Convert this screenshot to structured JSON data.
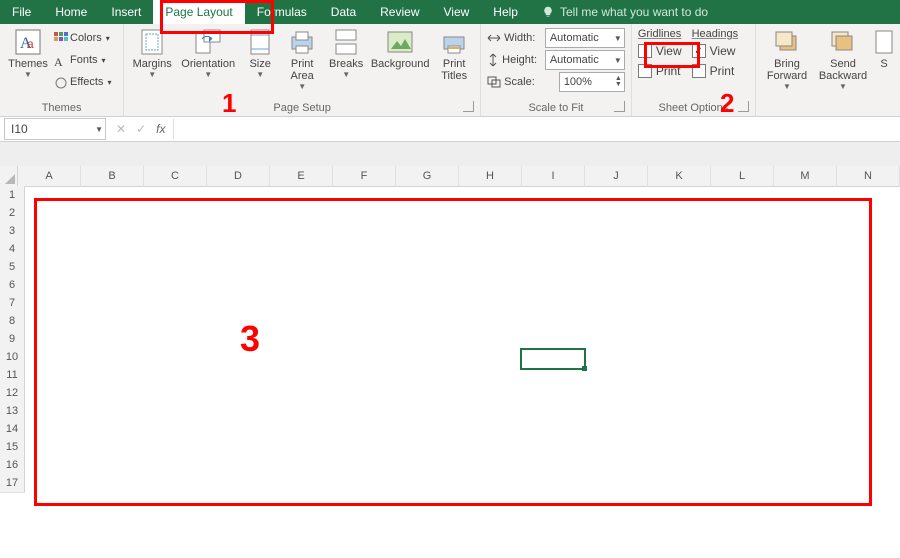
{
  "tabs": {
    "file": "File",
    "items": [
      "Home",
      "Insert",
      "Page Layout",
      "Formulas",
      "Data",
      "Review",
      "View",
      "Help"
    ],
    "active_index": 2,
    "tell_me": "Tell me what you want to do"
  },
  "ribbon": {
    "themes": {
      "title": "Themes",
      "themes_btn": "Themes",
      "colors": "Colors",
      "fonts": "Fonts",
      "effects": "Effects"
    },
    "pagesetup": {
      "title": "Page Setup",
      "margins": "Margins",
      "orientation": "Orientation",
      "size": "Size",
      "printarea": "Print\nArea",
      "breaks": "Breaks",
      "background": "Background",
      "printtitles": "Print\nTitles"
    },
    "scaletofit": {
      "title": "Scale to Fit",
      "width_lbl": "Width:",
      "height_lbl": "Height:",
      "scale_lbl": "Scale:",
      "width_val": "Automatic",
      "height_val": "Automatic",
      "scale_val": "100%"
    },
    "sheetoptions": {
      "title": "Sheet Options",
      "gridlines": "Gridlines",
      "headings": "Headings",
      "view": "View",
      "print": "Print",
      "grid_view_checked": false,
      "grid_print_checked": false,
      "head_view_checked": true,
      "head_print_checked": false
    },
    "arrange": {
      "bring": "Bring\nForward",
      "send": "Send\nBackward",
      "sel": "S"
    }
  },
  "formula_bar": {
    "name_box": "I10",
    "formula": ""
  },
  "grid": {
    "columns": [
      "A",
      "B",
      "C",
      "D",
      "E",
      "F",
      "G",
      "H",
      "I",
      "J",
      "K",
      "L",
      "M",
      "N"
    ],
    "rows": 17,
    "selected_cell": "I10"
  },
  "annotations": {
    "n1": "1",
    "n2": "2",
    "n3": "3"
  }
}
